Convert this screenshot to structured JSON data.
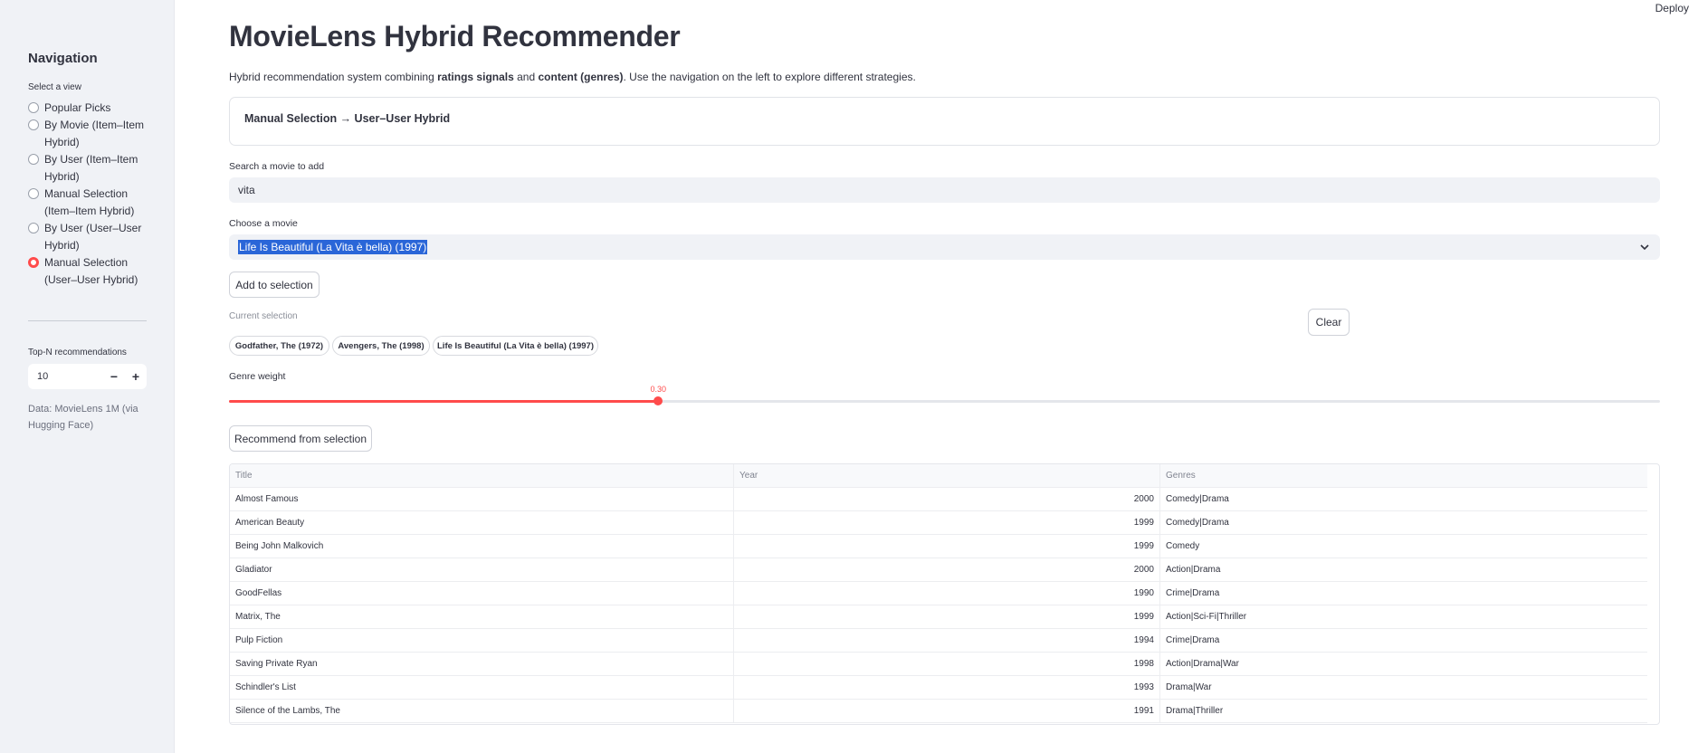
{
  "header": {
    "deploy_label": "Deploy"
  },
  "sidebar": {
    "title": "Navigation",
    "caption": "Select a view",
    "views": [
      {
        "label": "Popular Picks",
        "selected": false
      },
      {
        "label": "By Movie (Item–Item Hybrid)",
        "selected": false
      },
      {
        "label": "By User (Item–Item Hybrid)",
        "selected": false
      },
      {
        "label": "Manual Selection (Item–Item Hybrid)",
        "selected": false
      },
      {
        "label": "By User (User–User Hybrid)",
        "selected": false
      },
      {
        "label": "Manual Selection (User–User Hybrid)",
        "selected": true
      }
    ],
    "topn_label": "Top-N recommendations",
    "topn_value": "10",
    "minus": "−",
    "plus": "+",
    "data_note": "Data: MovieLens 1M (via Hugging Face)"
  },
  "main": {
    "title": "MovieLens Hybrid Recommender",
    "desc": {
      "prefix": "Hybrid recommendation system combining ",
      "bold1": "ratings signals",
      "mid": " and ",
      "bold2": "content (genres)",
      "suffix": ". Use the navigation on the left to explore different strategies."
    },
    "section_title": "Manual Selection → User–User Hybrid",
    "search_label": "Search a movie to add",
    "search_value": "vita",
    "choose_label": "Choose a movie",
    "choose_value": "Life Is Beautiful (La Vita è bella) (1997)",
    "add_button": "Add to selection",
    "current_selection_label": "Current selection",
    "clear_button": "Clear",
    "chips": [
      "Godfather, The (1972)",
      "Avengers, The (1998)",
      "Life Is Beautiful (La Vita è bella) (1997)"
    ],
    "genre_weight_label": "Genre weight",
    "genre_weight_value": 0.3,
    "genre_weight_text": "0.30",
    "recommend_button": "Recommend from selection",
    "table": {
      "columns": [
        "Title",
        "Year",
        "Genres"
      ],
      "rows": [
        [
          "Almost Famous",
          "2000",
          "Comedy|Drama"
        ],
        [
          "American Beauty",
          "1999",
          "Comedy|Drama"
        ],
        [
          "Being John Malkovich",
          "1999",
          "Comedy"
        ],
        [
          "Gladiator",
          "2000",
          "Action|Drama"
        ],
        [
          "GoodFellas",
          "1990",
          "Crime|Drama"
        ],
        [
          "Matrix, The",
          "1999",
          "Action|Sci-Fi|Thriller"
        ],
        [
          "Pulp Fiction",
          "1994",
          "Crime|Drama"
        ],
        [
          "Saving Private Ryan",
          "1998",
          "Action|Drama|War"
        ],
        [
          "Schindler's List",
          "1993",
          "Drama|War"
        ],
        [
          "Silence of the Lambs, The",
          "1991",
          "Drama|Thriller"
        ]
      ]
    }
  },
  "colors": {
    "accent": "#ff4b4b",
    "sidebar_bg": "#f0f2f6",
    "selection_bg": "#2a66d8"
  }
}
